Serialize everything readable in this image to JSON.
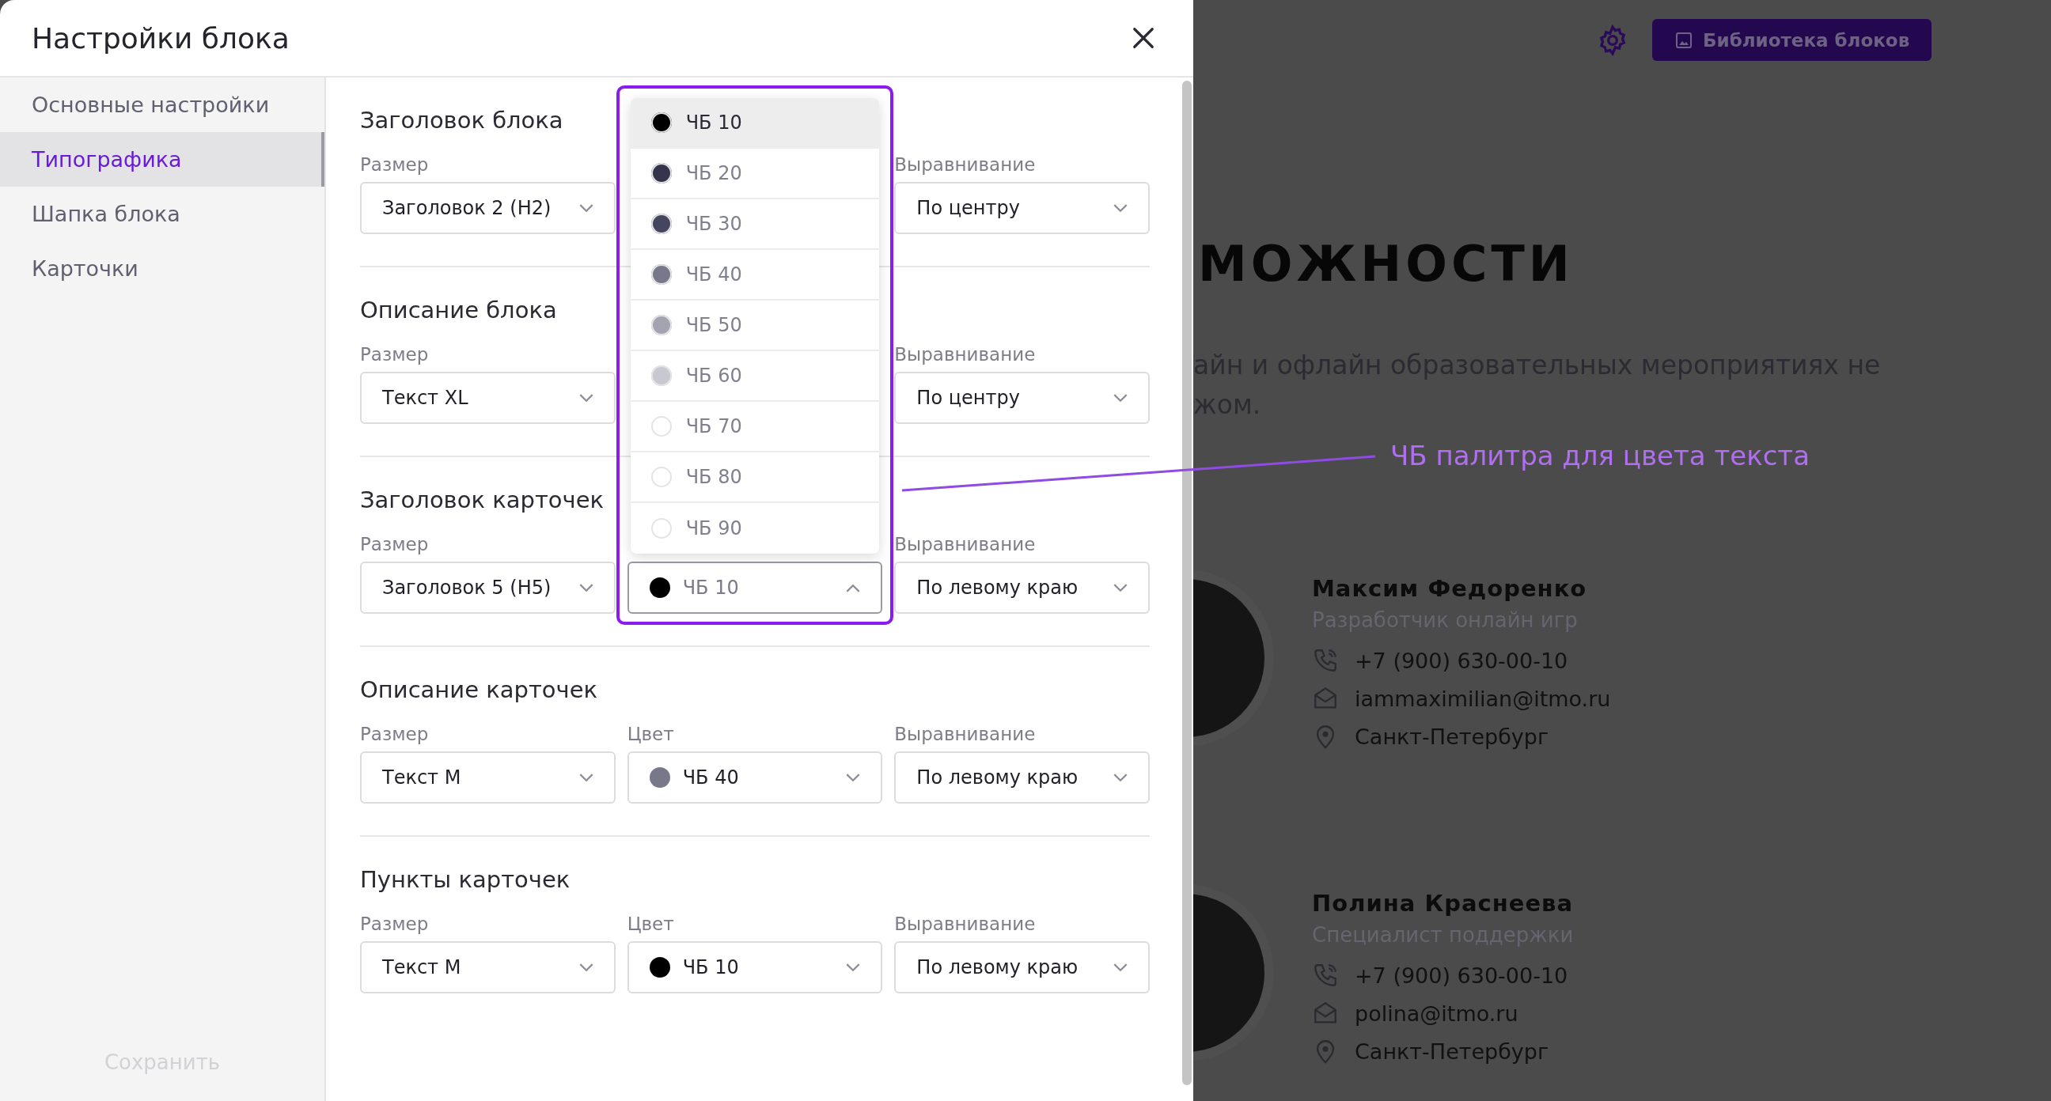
{
  "modal": {
    "title": "Настройки блока",
    "nav": [
      {
        "label": "Основные настройки",
        "selected": false
      },
      {
        "label": "Типографика",
        "selected": true
      },
      {
        "label": "Шапка блока",
        "selected": false
      },
      {
        "label": "Карточки",
        "selected": false
      }
    ],
    "save_button": {
      "label": "Сохранить",
      "disabled": true
    },
    "sections": [
      {
        "title": "Заголовок блока",
        "fields": [
          {
            "kind": "size",
            "label": "Размер",
            "value": "Заголовок 2 (H2)"
          },
          {
            "kind": "align",
            "label": "Выравнивание",
            "value": "По центру"
          }
        ]
      },
      {
        "title": "Описание блока",
        "fields": [
          {
            "kind": "size",
            "label": "Размер",
            "value": "Текст XL"
          },
          {
            "kind": "align",
            "label": "Выравнивание",
            "value": "По центру"
          }
        ]
      },
      {
        "title": "Заголовок карточек",
        "fields": [
          {
            "kind": "size",
            "label": "Размер",
            "value": "Заголовок 5 (H5)"
          },
          {
            "kind": "color",
            "value": "ЧБ 10",
            "color": "#000000",
            "open": true,
            "options": [
              {
                "label": "ЧБ 10",
                "color": "#000000",
                "selected": true
              },
              {
                "label": "ЧБ 20",
                "color": "#34354a",
                "selected": false
              },
              {
                "label": "ЧБ 30",
                "color": "#44465e",
                "selected": false
              },
              {
                "label": "ЧБ 40",
                "color": "#777889",
                "selected": false
              },
              {
                "label": "ЧБ 50",
                "color": "#a4a4b1",
                "selected": false
              },
              {
                "label": "ЧБ 60",
                "color": "#c8c8d1",
                "selected": false
              },
              {
                "label": "ЧБ 70",
                "color": "#ffffff",
                "selected": false
              },
              {
                "label": "ЧБ 80",
                "color": "#ffffff",
                "selected": false
              },
              {
                "label": "ЧБ 90",
                "color": "#ffffff",
                "selected": false
              }
            ]
          },
          {
            "kind": "align",
            "label": "Выравнивание",
            "value": "По левому краю"
          }
        ]
      },
      {
        "title": "Описание карточек",
        "fields": [
          {
            "kind": "size",
            "label": "Размер",
            "value": "Текст М"
          },
          {
            "kind": "color",
            "label": "Цвет",
            "value": "ЧБ 40",
            "color": "#777889",
            "open": false
          },
          {
            "kind": "align",
            "label": "Выравнивание",
            "value": "По левому краю"
          }
        ]
      },
      {
        "title": "Пункты карточек",
        "fields": [
          {
            "kind": "size",
            "label": "Размер",
            "value": "Текст М"
          },
          {
            "kind": "color",
            "label": "Цвет",
            "value": "ЧБ 10",
            "color": "#000000",
            "open": false
          },
          {
            "kind": "align",
            "label": "Выравнивание",
            "value": "По левому краю"
          }
        ]
      }
    ]
  },
  "annotation": {
    "text": "ЧБ палитра для цвета текста"
  },
  "background": {
    "library_button": "Библиотека блоков",
    "heading": "МОЖНОСТИ",
    "description": [
      "айн и офлайн образовательных мероприятиях не",
      "жом."
    ],
    "people": [
      {
        "name": "Максим Федоренко",
        "role": "Разработчик онлайн игр",
        "phone": "+7 (900) 630-00-10",
        "email": "iammaximilian@itmo.ru",
        "city": "Санкт-Петербург"
      },
      {
        "name": "Полина Краснеева",
        "role": "Специалист поддержки",
        "phone": "+7 (900) 630-00-10",
        "email": "polina@itmo.ru",
        "city": "Санкт-Петербург"
      }
    ]
  }
}
